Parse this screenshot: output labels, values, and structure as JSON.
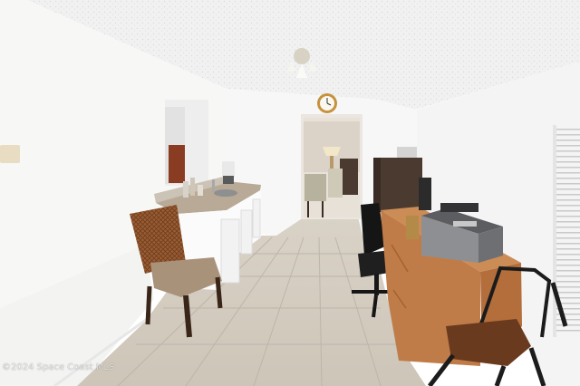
{
  "watermark": {
    "text": "©2024 Space Coast MLS"
  }
}
